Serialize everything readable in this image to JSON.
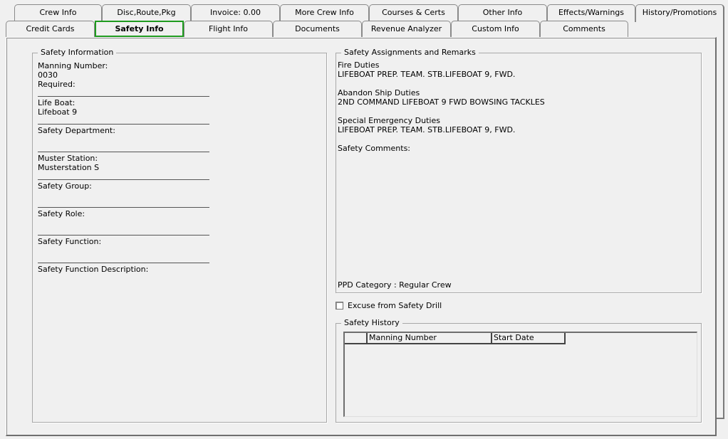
{
  "tabs": {
    "row1": [
      {
        "label": "Crew Info"
      },
      {
        "label": "Disc,Route,Pkg"
      },
      {
        "label": "Invoice: 0.00"
      },
      {
        "label": "More Crew Info"
      },
      {
        "label": "Courses & Certs"
      },
      {
        "label": "Other Info"
      },
      {
        "label": "Effects/Warnings"
      },
      {
        "label": "History/Promotions"
      }
    ],
    "row2": [
      {
        "label": "Credit Cards"
      },
      {
        "label": "Safety Info",
        "active": true
      },
      {
        "label": "Flight Info"
      },
      {
        "label": "Documents"
      },
      {
        "label": "Revenue Analyzer"
      },
      {
        "label": "Custom Info"
      },
      {
        "label": "Comments"
      }
    ],
    "active_color": "#1e9a1e"
  },
  "safety_information": {
    "title": "Safety Information",
    "fields": [
      {
        "label": "Manning Number:",
        "value": "0030"
      },
      {
        "label": "Required:",
        "value": ""
      },
      {
        "label": "Life Boat:",
        "value": "Lifeboat 9"
      },
      {
        "label": "Safety Department:",
        "value": ""
      },
      {
        "label": "Muster Station:",
        "value": "Musterstation S"
      },
      {
        "label": "Safety Group:",
        "value": ""
      },
      {
        "label": "Safety Role:",
        "value": ""
      },
      {
        "label": "Safety Function:",
        "value": ""
      },
      {
        "label": "Safety Function Description:",
        "value": ""
      }
    ]
  },
  "assignments": {
    "title": "Safety Assignments and Remarks",
    "fire_duties_label": "Fire Duties",
    "fire_duties_value": "LIFEBOAT PREP. TEAM. STB.LIFEBOAT 9, FWD.",
    "abandon_ship_label": "Abandon Ship Duties",
    "abandon_ship_value": "2ND COMMAND LIFEBOAT 9 FWD BOWSING TACKLES",
    "special_emergency_label": "Special Emergency Duties",
    "special_emergency_value": "LIFEBOAT PREP. TEAM. STB.LIFEBOAT 9, FWD.",
    "comments_label": "Safety Comments:",
    "comments_value": "",
    "ppd_category": "PPD Category : Regular Crew"
  },
  "excuse_drill": {
    "label": "Excuse from Safety Drill",
    "checked": false
  },
  "safety_history": {
    "title": "Safety History",
    "columns": [
      "Manning Number",
      "Start Date"
    ],
    "rows": []
  }
}
